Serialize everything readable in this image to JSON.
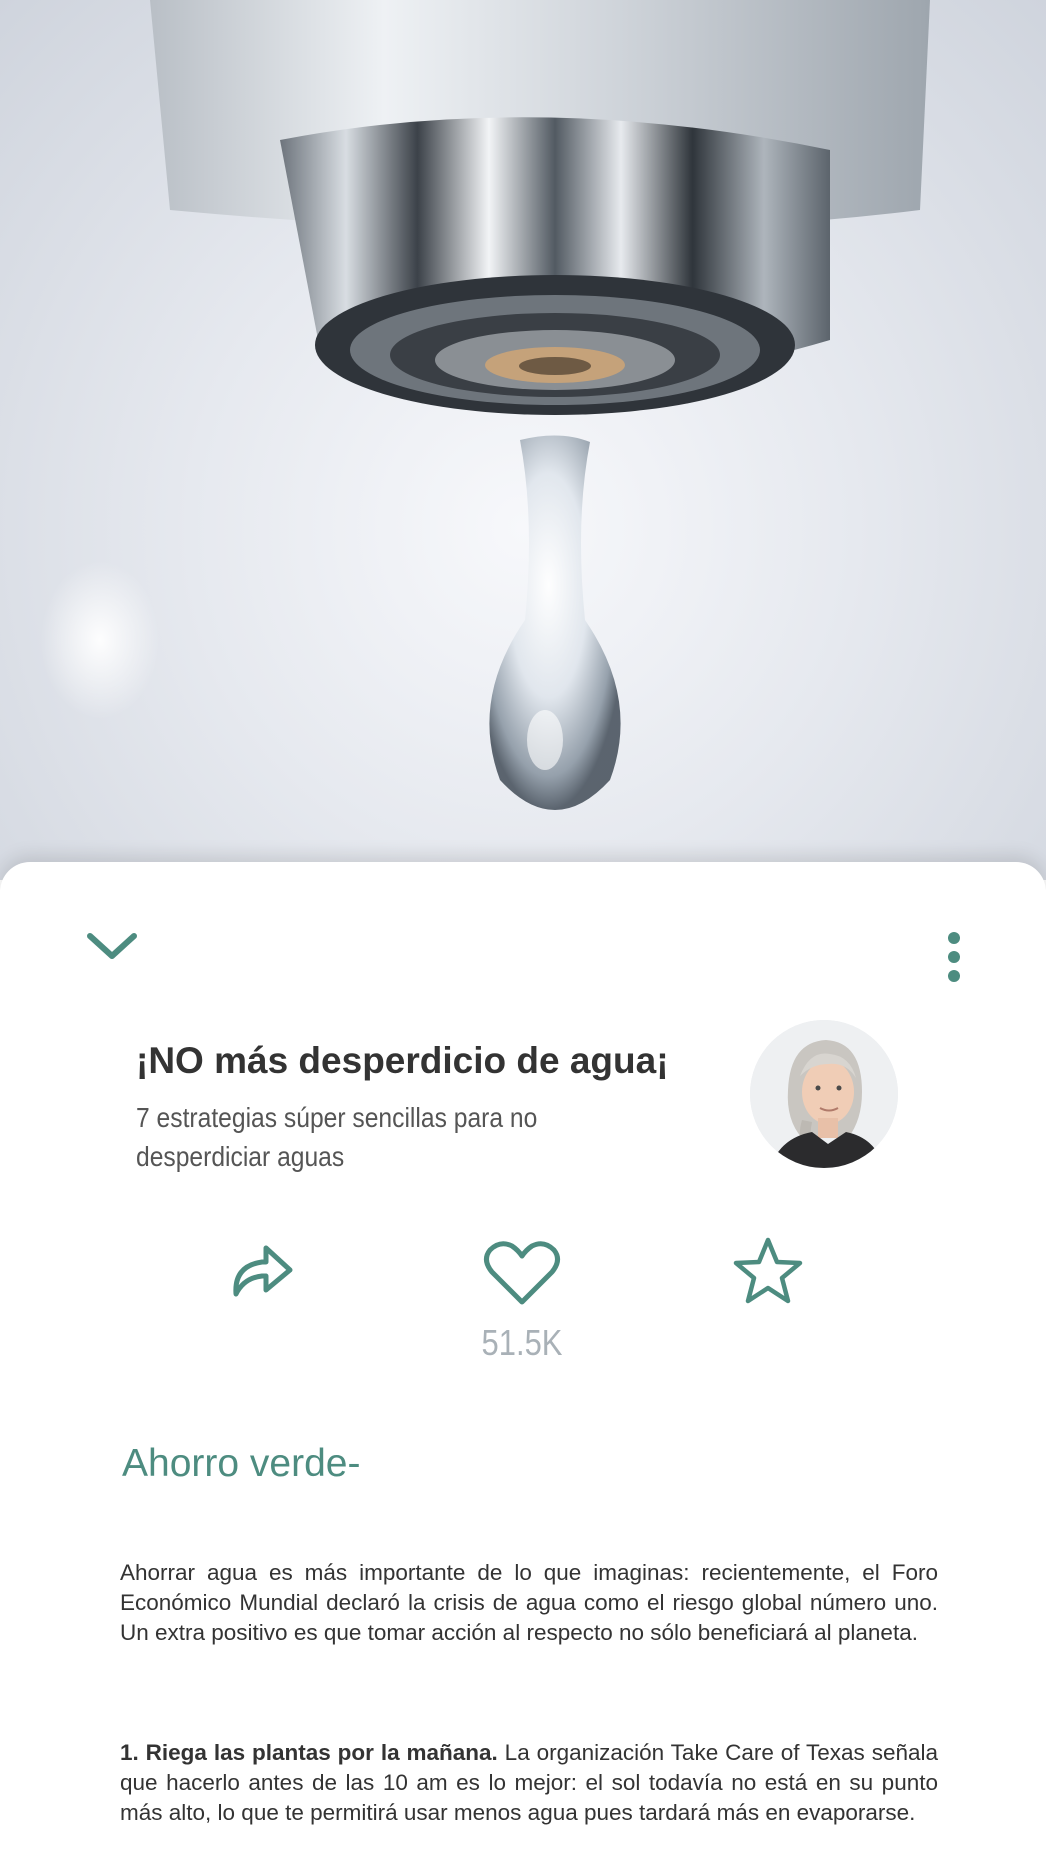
{
  "hero": {
    "image": "dripping-faucet-photo"
  },
  "toolbar": {
    "collapse_icon": "chevron-down-icon",
    "more_icon": "more-vertical-icon"
  },
  "article": {
    "title": "¡NO más desperdicio de agua¡",
    "subtitle": "7 estrategias súper sencillas para no desperdiciar aguas",
    "author_avatar": "avatar"
  },
  "actions": {
    "share_icon": "share-icon",
    "like_icon": "heart-icon",
    "favorite_icon": "star-icon",
    "likes_count": "51.5K"
  },
  "body": {
    "section_title": "Ahorro verde-",
    "paragraph1": "Ahorrar agua es más importante de lo que imaginas: recientemente, el Foro Económico Mundial declaró la crisis de agua como el riesgo global número uno. Un extra positivo es que tomar acción al respecto no sólo beneficiará al planeta.",
    "tip1_bold": "1. Riega las plantas por la mañana.",
    "tip1_text": " La organización Take Care of Texas señala que hacerlo antes de las 10 am es lo mejor: el sol todavía no está en su punto más alto, lo que te permitirá usar menos agua pues tardará más en evaporarse."
  },
  "colors": {
    "accent": "#4d8c80",
    "muted": "#a9b1b7",
    "text": "#333333"
  }
}
